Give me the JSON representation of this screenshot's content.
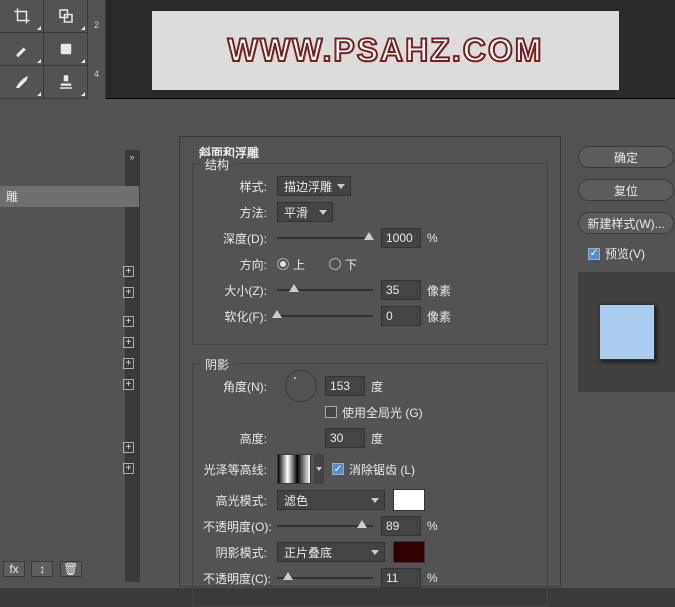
{
  "watermark_text": "WWW.PSAHZ.COM",
  "ruler_marks": [
    "2",
    "4"
  ],
  "panel_title": "斜面和浮雕",
  "group_structure": "结构",
  "group_shading": "阴影",
  "labels": {
    "style": "样式:",
    "technique": "方法:",
    "depth": "深度(D):",
    "direction": "方向:",
    "dir_up": "上",
    "dir_down": "下",
    "size": "大小(Z):",
    "soften": "软化(F):",
    "angle": "角度(N):",
    "use_global": "使用全局光 (G)",
    "altitude": "高度:",
    "gloss_contour": "光泽等高线:",
    "anti_alias": "消除锯齿 (L)",
    "highlight_mode": "高光模式:",
    "highlight_opacity": "不透明度(O):",
    "shadow_mode": "阴影模式:",
    "shadow_opacity": "不透明度(C):"
  },
  "values": {
    "style_sel": "描边浮雕",
    "technique_sel": "平滑",
    "depth": "1000",
    "size": "35",
    "soften": "0",
    "angle": "153",
    "altitude": "30",
    "highlight_mode": "滤色",
    "highlight_opacity": "89",
    "shadow_mode": "正片叠底",
    "shadow_opacity": "11"
  },
  "units": {
    "pct": "%",
    "px": "像素",
    "deg": "度"
  },
  "colors": {
    "highlight": "#ffffff",
    "shadow": "#330000"
  },
  "leftlist": {
    "selected_label": "雕"
  },
  "right": {
    "ok": "确定",
    "reset": "复位",
    "new_style": "新建样式(W)...",
    "preview": "预览(V)"
  }
}
